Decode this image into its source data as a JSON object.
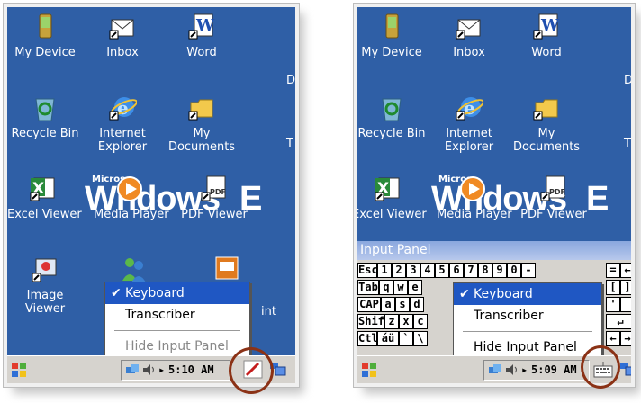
{
  "left_screen": {
    "desktop_icons": [
      {
        "label": "My Device",
        "icon": "pda-icon"
      },
      {
        "label": "Inbox",
        "icon": "envelope-icon"
      },
      {
        "label": "Word",
        "icon": "word-icon"
      },
      {
        "label": "Recycle Bin",
        "icon": "recycle-bin-icon"
      },
      {
        "label": "Internet",
        "label2": "Explorer",
        "icon": "ie-icon"
      },
      {
        "label": "My",
        "label2": "Documents",
        "icon": "folder-icon"
      },
      {
        "label": "Excel Viewer",
        "icon": "excel-icon"
      },
      {
        "label": "Media Player",
        "icon": "media-player-icon"
      },
      {
        "label": "PDF Viewer",
        "icon": "pdf-icon"
      },
      {
        "label": "Image",
        "label2": "Viewer",
        "icon": "image-viewer-icon"
      }
    ],
    "clipped_right": [
      "D",
      "T",
      "int"
    ],
    "windows_logo_text": "Wndows",
    "windows_logo_super": "Micros",
    "windows_logo_tail": "E",
    "menu": {
      "items": [
        "Keyboard",
        "Transcriber",
        "Hide Input Panel"
      ],
      "selected": "Keyboard",
      "disabled": "Hide Input Panel"
    },
    "clock": "5:10 AM",
    "sip_icon": "pen-input-icon"
  },
  "right_screen": {
    "desktop_icons": [
      {
        "label": "My Device"
      },
      {
        "label": "Inbox"
      },
      {
        "label": "Word"
      },
      {
        "label": "Recycle Bin"
      },
      {
        "label": "Internet",
        "label2": "Explorer"
      },
      {
        "label": "My",
        "label2": "Documents"
      },
      {
        "label": "Excel Viewer"
      },
      {
        "label": "Media Player"
      },
      {
        "label": "PDF Viewer"
      }
    ],
    "clipped_right": [
      "D",
      "T"
    ],
    "windows_logo_text": "Wndows",
    "windows_logo_super": "Micros",
    "windows_logo_tail": "E",
    "input_panel_title": "Input Panel",
    "keyboard_rows": [
      [
        "Esc",
        "1",
        "2",
        "3",
        "4",
        "5",
        "6",
        "7",
        "8",
        "9",
        "0",
        "-",
        "=",
        "←"
      ],
      [
        "Tab",
        "q",
        "w",
        "e",
        "",
        "",
        "",
        "",
        "",
        "",
        "",
        "[",
        "]"
      ],
      [
        "CAP",
        "a",
        "s",
        "d",
        "",
        "",
        "",
        "",
        "",
        "",
        "",
        "'",
        ""
      ],
      [
        "Shift",
        "z",
        "x",
        "c",
        "",
        "",
        "",
        "",
        "",
        "",
        "",
        "↵"
      ],
      [
        "Ctl",
        "áü",
        "`",
        "\\",
        "",
        "",
        "",
        "",
        "",
        "",
        "",
        "←",
        "→"
      ]
    ],
    "menu": {
      "items": [
        "Keyboard",
        "Transcriber",
        "Hide Input Panel"
      ],
      "selected": "Keyboard"
    },
    "clock": "5:09 AM",
    "sip_icon": "keyboard-icon"
  }
}
